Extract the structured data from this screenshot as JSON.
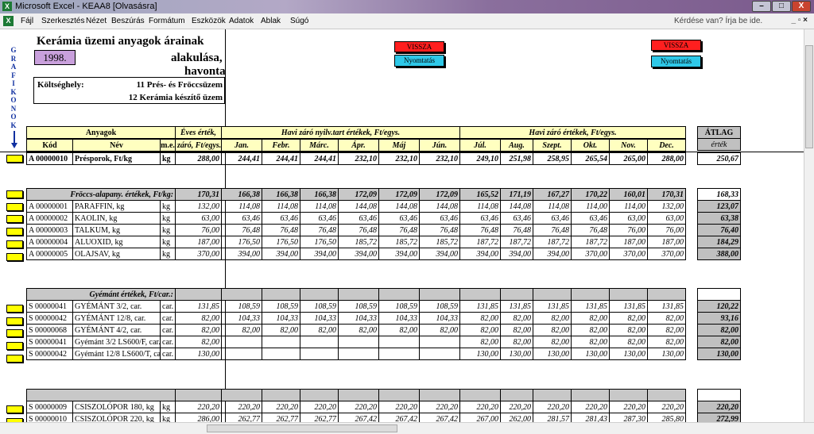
{
  "window": {
    "title": "Microsoft Excel - KEAA8  [Olvasásra]",
    "min": "–",
    "max": "□",
    "close": "X"
  },
  "menus": [
    "Fájl",
    "Szerkesztés",
    "Nézet",
    "Beszúrás",
    "Formátum",
    "Eszközök",
    "Adatok",
    "Ablak",
    "Súgó"
  ],
  "help_box": "Kérdése van? Írja be ide.",
  "menu_controls": "_ ▫ ×",
  "sheet": {
    "title1": "Kerámia üzemi anyagok árainak",
    "year": "1998.",
    "title2": "alakulása,",
    "title3": "havonta",
    "koltseghely_label": "Költséghely:",
    "koltseghely_1": "11 Prés- és Fröccsüzem",
    "koltseghely_2": "12 Kerámia készítő üzem",
    "grafikonok": [
      "G",
      "R",
      "A",
      "F",
      "I",
      "K",
      "O",
      "N",
      "O",
      "K"
    ],
    "btn_vissza": "VISSZA",
    "btn_nyomtatas": "Nyomtatás"
  },
  "header": {
    "anyagok": "Anyagok",
    "eves": "Éves érték,",
    "eves2": "záró, Ft/egys.",
    "havi1": "Havi záró nyilv.tart értékek, Ft/egys.",
    "havi2": "Havi záró értékek, Ft/egys.",
    "kod": "Kód",
    "nev": "Név",
    "me": "m.e.",
    "months": [
      "Jan.",
      "Febr.",
      "Márc.",
      "Ápr.",
      "Máj",
      "Jún.",
      "Júl.",
      "Aug.",
      "Szept.",
      "Okt.",
      "Nov.",
      "Dec."
    ],
    "atlag": "ÁTLAG",
    "atlag2": "érték"
  },
  "row_presporok": {
    "code": "A 00000010",
    "name": "Présporok, Ft/kg",
    "unit": "kg",
    "year": "288,00",
    "m": [
      "244,41",
      "244,41",
      "244,41",
      "232,10",
      "232,10",
      "232,10",
      "249,10",
      "251,98",
      "258,95",
      "265,54",
      "265,00",
      "288,00"
    ],
    "avg": "250,67"
  },
  "group_froccs": {
    "label": "Fröccs-alapany. értékek, Ft/kg:",
    "year": "170,31",
    "m": [
      "166,38",
      "166,38",
      "166,38",
      "172,09",
      "172,09",
      "172,09",
      "165,52",
      "171,19",
      "167,27",
      "170,22",
      "160,01",
      "170,31"
    ],
    "avg": "168,33",
    "rows": [
      {
        "code": "A 00000001",
        "name": "PARAFFIN, kg",
        "unit": "kg",
        "year": "132,00",
        "m": [
          "114,08",
          "114,08",
          "114,08",
          "144,08",
          "144,08",
          "144,08",
          "114,08",
          "144,08",
          "114,08",
          "114,00",
          "114,00",
          "132,00"
        ],
        "avg": "123,07"
      },
      {
        "code": "A 00000002",
        "name": "KAOLIN, kg",
        "unit": "kg",
        "year": "63,00",
        "m": [
          "63,46",
          "63,46",
          "63,46",
          "63,46",
          "63,46",
          "63,46",
          "63,46",
          "63,46",
          "63,46",
          "63,46",
          "63,00",
          "63,00"
        ],
        "avg": "63,38"
      },
      {
        "code": "A 00000003",
        "name": "TALKUM, kg",
        "unit": "kg",
        "year": "76,00",
        "m": [
          "76,48",
          "76,48",
          "76,48",
          "76,48",
          "76,48",
          "76,48",
          "76,48",
          "76,48",
          "76,48",
          "76,48",
          "76,00",
          "76,00"
        ],
        "avg": "76,40"
      },
      {
        "code": "A 00000004",
        "name": "ALUOXID, kg",
        "unit": "kg",
        "year": "187,00",
        "m": [
          "176,50",
          "176,50",
          "176,50",
          "185,72",
          "185,72",
          "185,72",
          "187,72",
          "187,72",
          "187,72",
          "187,72",
          "187,00",
          "187,00"
        ],
        "avg": "184,29"
      },
      {
        "code": "A 00000005",
        "name": "OLAJSAV, kg",
        "unit": "kg",
        "year": "370,00",
        "m": [
          "394,00",
          "394,00",
          "394,00",
          "394,00",
          "394,00",
          "394,00",
          "394,00",
          "394,00",
          "394,00",
          "370,00",
          "370,00",
          "370,00"
        ],
        "avg": "388,00"
      }
    ]
  },
  "group_gyemant": {
    "label": "Gyémánt értékek, Ft/car.:",
    "rows": [
      {
        "code": "S  00000041",
        "name": "GYÉMÁNT 3/2, car.",
        "unit": "car.",
        "year": "131,85",
        "m": [
          "108,59",
          "108,59",
          "108,59",
          "108,59",
          "108,59",
          "108,59",
          "131,85",
          "131,85",
          "131,85",
          "131,85",
          "131,85",
          "131,85"
        ],
        "avg": "120,22"
      },
      {
        "code": "S  00000042",
        "name": "GYÉMÁNT 12/8, car.",
        "unit": "car.",
        "year": "82,00",
        "m": [
          "104,33",
          "104,33",
          "104,33",
          "104,33",
          "104,33",
          "104,33",
          "82,00",
          "82,00",
          "82,00",
          "82,00",
          "82,00",
          "82,00"
        ],
        "avg": "93,16"
      },
      {
        "code": "S  00000068",
        "name": "GYÉMÁNT 4/2, car.",
        "unit": "car.",
        "year": "82,00",
        "m": [
          "82,00",
          "82,00",
          "82,00",
          "82,00",
          "82,00",
          "82,00",
          "82,00",
          "82,00",
          "82,00",
          "82,00",
          "82,00",
          "82,00"
        ],
        "avg": "82,00"
      },
      {
        "code": "S  00000041",
        "name": "Gyémánt 3/2 LS600/F, car.",
        "unit": "car.",
        "year": "82,00",
        "m": [
          "",
          "",
          "",
          "",
          "",
          "",
          "82,00",
          "82,00",
          "82,00",
          "82,00",
          "82,00",
          "82,00"
        ],
        "avg": "82,00"
      },
      {
        "code": "S  00000042",
        "name": "Gyémánt 12/8 LS600/T, car.",
        "unit": "car.",
        "year": "130,00",
        "m": [
          "",
          "",
          "",
          "",
          "",
          "",
          "130,00",
          "130,00",
          "130,00",
          "130,00",
          "130,00",
          "130,00"
        ],
        "avg": "130,00"
      }
    ]
  },
  "group_csiszolo": {
    "rows": [
      {
        "code": "S  00000009",
        "name": "CSISZOLÓPOR 180, kg",
        "unit": "kg",
        "year": "220,20",
        "m": [
          "220,20",
          "220,20",
          "220,20",
          "220,20",
          "220,20",
          "220,20",
          "220,20",
          "220,20",
          "220,20",
          "220,20",
          "220,20",
          "220,20"
        ],
        "avg": "220,20"
      },
      {
        "code": "S  00000010",
        "name": "CSISZOLÓPOR 220, kg",
        "unit": "kg",
        "year": "286,00",
        "m": [
          "262,77",
          "262,77",
          "262,77",
          "267,42",
          "267,42",
          "267,42",
          "267,00",
          "262,00",
          "281,57",
          "281,43",
          "287,30",
          "285,80"
        ],
        "avg": "272,99"
      }
    ]
  }
}
